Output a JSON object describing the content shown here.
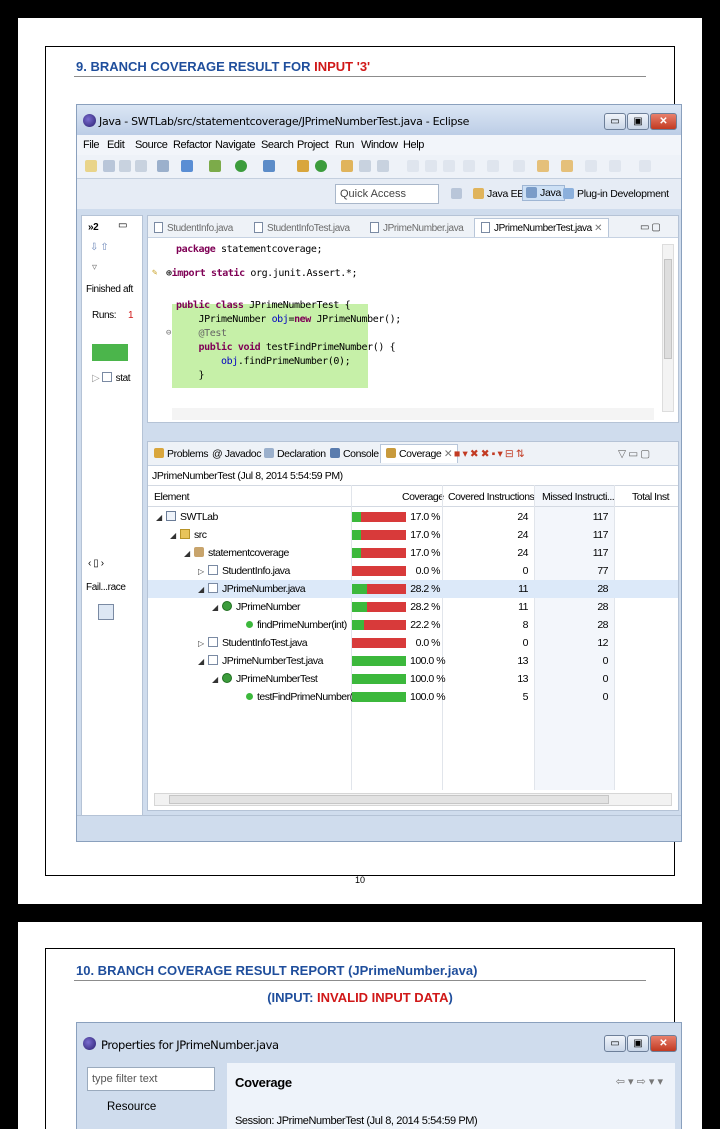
{
  "page1": {
    "heading_prefix": "9. BRANCH COVERAGE RESULT FOR ",
    "heading_highlight": "INPUT '3'",
    "page_number": "10"
  },
  "window": {
    "title": "Java - SWTLab/src/statementcoverage/JPrimeNumberTest.java - Eclipse",
    "min_label": "▭",
    "max_label": "▣",
    "close_label": "✕"
  },
  "menu": [
    "File",
    "Edit",
    "Source",
    "Refactor",
    "Navigate",
    "Search",
    "Project",
    "Run",
    "Window",
    "Help"
  ],
  "quick_access": "Quick Access",
  "perspectives": [
    "Java EE",
    "Java",
    "Plug-in Development"
  ],
  "junit_view": {
    "tab": "»2",
    "finished": "Finished aft",
    "runs": "Runs:",
    "runs_value": "1",
    "tree_item": "stat",
    "failure_trace": "Fail...race"
  },
  "editor_tabs": [
    "StudentInfo.java",
    "StudentInfoTest.java",
    "JPrimeNumber.java",
    "JPrimeNumberTest.java"
  ],
  "code": {
    "line1_kw": "package",
    "line1_rest": " statementcoverage;",
    "line2_kw": "import static",
    "line2_rest": " org.junit.Assert.*;",
    "line3_kw": "public class",
    "line3_rest": " JPrimeNumberTest {",
    "line4_a": "    JPrimeNumber ",
    "line4_b": "obj",
    "line4_c": "=",
    "line4_kw": "new",
    "line4_d": " JPrimeNumber();",
    "line5": "    @Test",
    "line6_kw": "    public void",
    "line6_rest": " testFindPrimeNumber() {",
    "line7_a": "        ",
    "line7_b": "obj",
    "line7_c": ".findPrimeNumber(0);",
    "line8": "    }"
  },
  "view_tabs": [
    "Problems",
    "@ Javadoc",
    "Declaration",
    "Console",
    "Coverage"
  ],
  "session": "JPrimeNumberTest (Jul 8, 2014 5:54:59 PM)",
  "columns": [
    "Element",
    "Coverage",
    "Covered Instructions",
    "Missed Instructi...",
    "Total Inst"
  ],
  "rows": [
    {
      "name": "SWTLab",
      "coverage": "17.0 %",
      "covered": "24",
      "missed": "117"
    },
    {
      "name": "src",
      "coverage": "17.0 %",
      "covered": "24",
      "missed": "117"
    },
    {
      "name": "statementcoverage",
      "coverage": "17.0 %",
      "covered": "24",
      "missed": "117"
    },
    {
      "name": "StudentInfo.java",
      "coverage": "0.0 %",
      "covered": "0",
      "missed": "77"
    },
    {
      "name": "JPrimeNumber.java",
      "coverage": "28.2 %",
      "covered": "11",
      "missed": "28"
    },
    {
      "name": "JPrimeNumber",
      "coverage": "28.2 %",
      "covered": "11",
      "missed": "28"
    },
    {
      "name": "findPrimeNumber(int)",
      "coverage": "22.2 %",
      "covered": "8",
      "missed": "28"
    },
    {
      "name": "StudentInfoTest.java",
      "coverage": "0.0 %",
      "covered": "0",
      "missed": "12"
    },
    {
      "name": "JPrimeNumberTest.java",
      "coverage": "100.0 %",
      "covered": "13",
      "missed": "0"
    },
    {
      "name": "JPrimeNumberTest",
      "coverage": "100.0 %",
      "covered": "13",
      "missed": "0"
    },
    {
      "name": "testFindPrimeNumber()",
      "coverage": "100.0 %",
      "covered": "5",
      "missed": "0"
    }
  ],
  "page2": {
    "heading_prefix": "10. BRANCH COVERAGE RESULT REPORT (JPrimeNumber.java)",
    "sub_open": "(INPUT: ",
    "sub_highlight": "INVALID INPUT DATA",
    "sub_close": ")",
    "window_title": "Properties for JPrimeNumber.java",
    "filter_placeholder": "type filter text",
    "panel_title": "Coverage",
    "session": "Session:  JPrimeNumberTest (Jul 8, 2014 5:54:59 PM)",
    "resource": "Resource",
    "nav": "⇦ ▾ ⇨ ▾ ▾"
  },
  "colors": {
    "covered": "#3cb83c",
    "missed": "#d83a3a",
    "heading": "#1f4e9c",
    "highlight": "#d01818"
  }
}
